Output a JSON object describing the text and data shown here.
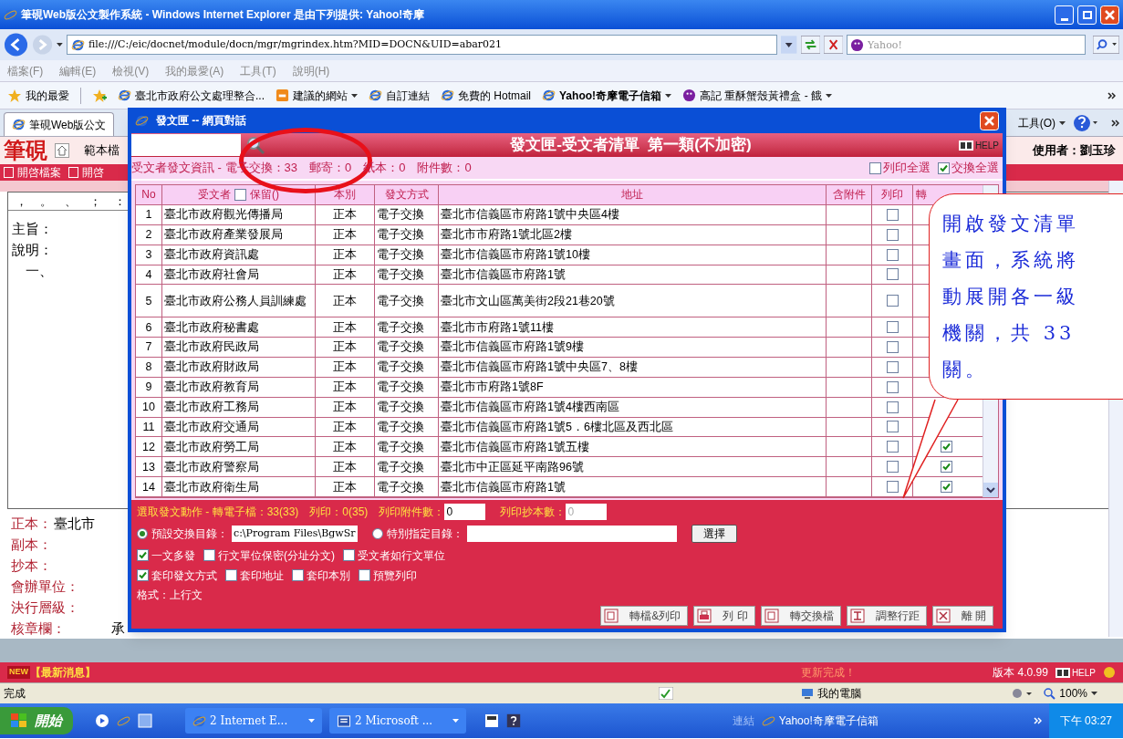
{
  "ie_window": {
    "title": "筆硯Web版公文製作系統 - Windows Internet Explorer 是由下列提供: Yahoo!奇摩",
    "address": "file:///C:/eic/docnet/module/docn/mgr/mgrindex.htm?MID=DOCN&UID=abar021",
    "search_placeholder": "Yahoo!",
    "menu": [
      "檔案(F)",
      "編輯(E)",
      "檢視(V)",
      "我的最愛(A)",
      "工具(T)",
      "說明(H)"
    ],
    "favorites_label": "我的最愛",
    "links": [
      {
        "label": "臺北市政府公文處理整合...",
        "kind": "page",
        "dropdown": false,
        "bold": false
      },
      {
        "label": "建議的網站",
        "kind": "feed",
        "dropdown": true,
        "bold": false
      },
      {
        "label": "自訂連結",
        "kind": "page",
        "dropdown": false,
        "bold": false
      },
      {
        "label": "免費的 Hotmail",
        "kind": "page",
        "dropdown": false,
        "bold": false
      },
      {
        "label": "Yahoo!奇摩電子信箱",
        "kind": "page",
        "dropdown": true,
        "bold": true
      },
      {
        "label": "高記 重酥蟹殼黃禮盒 - 餓",
        "kind": "yahoo",
        "dropdown": true,
        "bold": false
      }
    ],
    "tab": "筆硯Web版公文",
    "tools": "工具(O)"
  },
  "app": {
    "logo": "筆硯",
    "template_label": "範本檔",
    "user": "使用者：劉玉珍",
    "toolbar": [
      "開啓檔案",
      "開啓"
    ],
    "punctuation": [
      "，",
      "。",
      "、",
      "；",
      "："
    ],
    "editor_lines": [
      "主旨：",
      "說明：",
      "　一、"
    ],
    "fields": [
      {
        "label": "正本：",
        "value": "臺北市"
      },
      {
        "label": "副本："
      },
      {
        "label": "抄本："
      },
      {
        "label": "會辦單位："
      },
      {
        "label": "決行層級："
      },
      {
        "label": "核章欄：",
        "value": "承"
      }
    ]
  },
  "dialog": {
    "title": "發文匣 -- 網頁對話",
    "heading": "發文匣-受文者清單  第一類(不加密)",
    "help": "HELP",
    "info": "受文者發文資訊 - 電子交換：33　郵寄：0　紙本：0　附件數：0",
    "select_all": [
      {
        "label": "列印全選",
        "checked": false
      },
      {
        "label": "交換全選",
        "checked": true
      }
    ],
    "columns": [
      "No",
      "受文者",
      "本別",
      "發文方式",
      "地址",
      "含附件",
      "列印",
      "轉"
    ],
    "keep_label": "保留()",
    "keep_checked": false,
    "rows": [
      {
        "no": "1",
        "recipient": "臺北市政府觀光傳播局",
        "copy": "正本",
        "method": "電子交換",
        "address": "臺北市信義區市府路1號中央區4樓",
        "print": false
      },
      {
        "no": "2",
        "recipient": "臺北市政府產業發展局",
        "copy": "正本",
        "method": "電子交換",
        "address": "臺北市市府路1號北區2樓",
        "print": false
      },
      {
        "no": "3",
        "recipient": "臺北市政府資訊處",
        "copy": "正本",
        "method": "電子交換",
        "address": "臺北市信義區市府路1號10樓",
        "print": false
      },
      {
        "no": "4",
        "recipient": "臺北市政府社會局",
        "copy": "正本",
        "method": "電子交換",
        "address": "臺北市信義區市府路1號",
        "print": false
      },
      {
        "no": "5",
        "recipient": "臺北市政府公務人員訓練處",
        "copy": "正本",
        "method": "電子交換",
        "address": "臺北市文山區萬美街2段21巷20號",
        "print": false
      },
      {
        "no": "6",
        "recipient": "臺北市政府秘書處",
        "copy": "正本",
        "method": "電子交換",
        "address": "臺北市市府路1號11樓",
        "print": false
      },
      {
        "no": "7",
        "recipient": "臺北市政府民政局",
        "copy": "正本",
        "method": "電子交換",
        "address": "臺北市信義區市府路1號9樓",
        "print": false
      },
      {
        "no": "8",
        "recipient": "臺北市政府財政局",
        "copy": "正本",
        "method": "電子交換",
        "address": "臺北市信義區市府路1號中央區7、8樓",
        "print": false
      },
      {
        "no": "9",
        "recipient": "臺北市政府教育局",
        "copy": "正本",
        "method": "電子交換",
        "address": "臺北市市府路1號8F",
        "print": false
      },
      {
        "no": "10",
        "recipient": "臺北市政府工務局",
        "copy": "正本",
        "method": "電子交換",
        "address": "臺北市信義區市府路1號4樓西南區",
        "print": false
      },
      {
        "no": "11",
        "recipient": "臺北市政府交通局",
        "copy": "正本",
        "method": "電子交換",
        "address": "臺北市信義區市府路1號5．6樓北區及西北區",
        "print": false
      },
      {
        "no": "12",
        "recipient": "臺北市政府勞工局",
        "copy": "正本",
        "method": "電子交換",
        "address": "臺北市信義區市府路1號五樓",
        "print": false,
        "exchange": true
      },
      {
        "no": "13",
        "recipient": "臺北市政府警察局",
        "copy": "正本",
        "method": "電子交換",
        "address": "臺北市中正區延平南路96號",
        "print": false,
        "exchange": true
      },
      {
        "no": "14",
        "recipient": "臺北市政府衛生局",
        "copy": "正本",
        "method": "電子交換",
        "address": "臺北市信義區市府路1號",
        "print": false,
        "exchange": true
      }
    ],
    "actions": {
      "summary": "選取發文動作 - 轉電子檔：33(33)　列印：0(35)　列印附件數：",
      "attach_count": "0",
      "copies_label": "列印抄本數：",
      "copies_value": "0",
      "directories": [
        {
          "label": "預設交換目錄：",
          "value": "c:\\Program Files\\BgwSr",
          "selected": true
        },
        {
          "label": "特別指定目錄：",
          "selected": false
        }
      ],
      "choose": "選擇",
      "options": [
        [
          {
            "label": "一文多發",
            "checked": true
          },
          {
            "label": "行文單位保密(分址分文)",
            "checked": false
          },
          {
            "label": "受文者如行文單位",
            "checked": false
          }
        ],
        [
          {
            "label": "套印發文方式",
            "checked": true
          },
          {
            "label": "套印地址",
            "checked": false
          },
          {
            "label": "套印本別",
            "checked": false
          },
          {
            "label": "預覽列印",
            "checked": false
          }
        ]
      ],
      "format": "格式：上行文",
      "buttons": [
        {
          "label": "轉檔&列印",
          "kind": "doc"
        },
        {
          "label": "列 印",
          "kind": "printer"
        },
        {
          "label": "轉交換檔",
          "kind": "doc"
        },
        {
          "label": "調整行距",
          "kind": "spacing"
        },
        {
          "label": "離 開",
          "kind": "close"
        }
      ]
    }
  },
  "callout_lines": [
    "開啟發文清單",
    "畫面，系統將",
    "動展開各一級",
    "機關，共 33",
    "關。"
  ],
  "news_bar": {
    "badge": "NEW",
    "news": "【最新消息】",
    "update": "更新完成！",
    "version": "版本 4.0.99",
    "help": "HELP"
  },
  "status_bar": {
    "text": "完成",
    "zone": "我的電腦",
    "zoom": "100%"
  },
  "taskbar": {
    "start": "開始",
    "tasks": [
      {
        "label": "2 Internet E...",
        "kind": "browser"
      },
      {
        "label": "2 Microsoft ...",
        "kind": "word"
      }
    ],
    "links_label": "連結",
    "link": "Yahoo!奇摩電子信箱",
    "clock": "下午 03:27"
  }
}
